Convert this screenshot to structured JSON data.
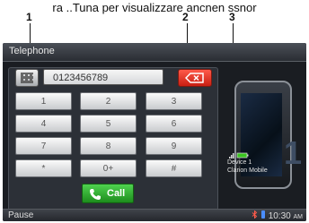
{
  "caption": "ra ..Tuna per visualizzare ancnen ssnor",
  "callouts": [
    {
      "label": "1"
    },
    {
      "label": "2"
    },
    {
      "label": "3"
    }
  ],
  "header": {
    "title": "Telephone"
  },
  "dialer": {
    "number": "0123456789",
    "keys": [
      "1",
      "2",
      "3",
      "4",
      "5",
      "6",
      "7",
      "8",
      "9",
      "*",
      "0+",
      "#"
    ],
    "call_label": "Call"
  },
  "device": {
    "name": "Device 1",
    "model": "Clarion Mobile",
    "slot_number": "1"
  },
  "status": {
    "left_label": "Pause",
    "time": "10:30",
    "ampm": "AM"
  },
  "colors": {
    "call": "#22a022",
    "backspace": "#d82b1b",
    "panel": "#2c3037"
  }
}
